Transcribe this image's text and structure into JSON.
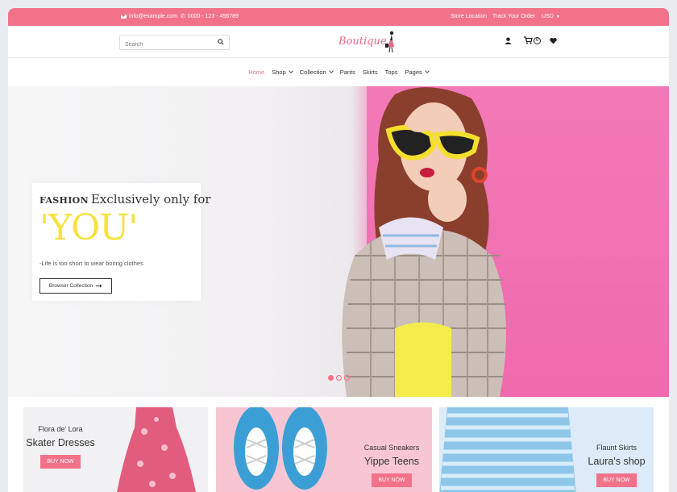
{
  "topbar": {
    "email": "info@example.com",
    "phone": "0000 - 123 - 456789",
    "store_location": "Store Location",
    "track_order": "Track Your Order",
    "currency": "USD"
  },
  "header": {
    "search_placeholder": "Search",
    "logo_text": "Boutique",
    "cart_count": "0"
  },
  "nav": {
    "items": [
      {
        "label": "Home",
        "active": true,
        "dropdown": false
      },
      {
        "label": "Shop",
        "dropdown": true
      },
      {
        "label": "Collection",
        "dropdown": true
      },
      {
        "label": "Pants",
        "dropdown": false
      },
      {
        "label": "Skirts",
        "dropdown": false
      },
      {
        "label": "Tops",
        "dropdown": false
      },
      {
        "label": "Pages",
        "dropdown": true
      }
    ]
  },
  "hero": {
    "fashion": "FASHION",
    "headline": "Exclusively only for",
    "highlight": "'YOU'",
    "subtitle": "-Life is too short to wear boring clothes",
    "button": "Browser Collection",
    "slide_count": 3,
    "active_slide": 1
  },
  "banners": [
    {
      "small": "Flora de' Lora",
      "big": "Skater Dresses",
      "button": "BUY NOW"
    },
    {
      "small": "Casual Sneakers",
      "big": "Yippe Teens",
      "button": "BUY NOW"
    },
    {
      "small": "Flaunt Skirts",
      "big": "Laura's shop",
      "button": "BUY NOW"
    }
  ],
  "colors": {
    "accent": "#f2728a",
    "highlight": "#f7e13e",
    "hero_wall": "#f177b6"
  }
}
